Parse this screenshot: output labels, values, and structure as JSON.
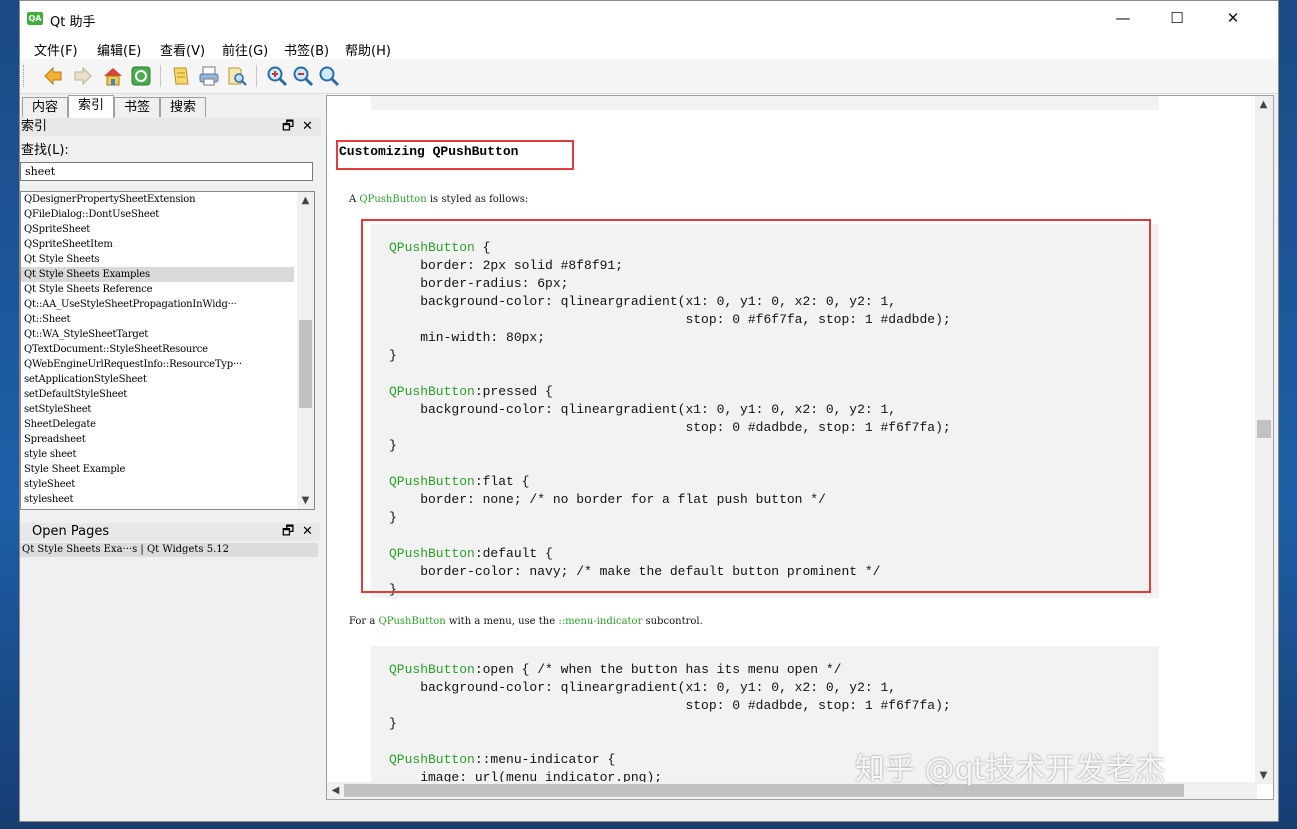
{
  "window": {
    "title": "Qt 助手",
    "icon_text": "QA",
    "controls": {
      "minimize": "—",
      "maximize": "☐",
      "close": "✕"
    }
  },
  "menubar": [
    "文件(F)",
    "编辑(E)",
    "查看(V)",
    "前往(G)",
    "书签(B)",
    "帮助(H)"
  ],
  "toolbar": {
    "buttons": [
      "back-arrow-icon",
      "forward-arrow-icon",
      "home-icon",
      "sync-icon",
      "bookmarks-icon",
      "print-icon",
      "find-icon",
      "zoom-in-icon",
      "zoom-out-icon",
      "zoom-reset-icon"
    ]
  },
  "left_panel": {
    "tabs": [
      "内容",
      "索引",
      "书签",
      "搜索"
    ],
    "active_tab": "索引",
    "index_dock_title": "索引",
    "find_label": "查找(L):",
    "find_value": "sheet",
    "index_items": [
      "QDesignerPropertySheetExtension",
      "QFileDialog::DontUseSheet",
      "QSpriteSheet",
      "QSpriteSheetItem",
      "Qt Style Sheets",
      "Qt Style Sheets Examples",
      "Qt Style Sheets Reference",
      "Qt::AA_UseStyleSheetPropagationInWidg···",
      "Qt::Sheet",
      "Qt::WA_StyleSheetTarget",
      "QTextDocument::StyleSheetResource",
      "QWebEngineUrlRequestInfo::ResourceTyp···",
      "setApplicationStyleSheet",
      "setDefaultStyleSheet",
      "setStyleSheet",
      "SheetDelegate",
      "Spreadsheet",
      "style sheet",
      "Style Sheet Example",
      "styleSheet",
      "stylesheet"
    ],
    "selected_index": 5,
    "open_pages_title": "Open Pages",
    "open_pages": [
      "Qt Style Sheets Exa···s | Qt Widgets 5.12"
    ],
    "dock_float": "🗗",
    "dock_close": "✕"
  },
  "content": {
    "heading": "Customizing QPushButton",
    "intro_prefix": "A ",
    "intro_link": "QPushButton",
    "intro_suffix": " is styled as follows:",
    "code1": [
      [
        "QPushButton",
        " {"
      ],
      [
        "",
        "    border: 2px solid #8f8f91;"
      ],
      [
        "",
        "    border-radius: 6px;"
      ],
      [
        "",
        "    background-color: qlineargradient(x1: 0, y1: 0, x2: 0, y2: 1,"
      ],
      [
        "",
        "                                      stop: 0 #f6f7fa, stop: 1 #dadbde);"
      ],
      [
        "",
        "    min-width: 80px;"
      ],
      [
        "",
        "}"
      ],
      [
        "",
        ""
      ],
      [
        "QPushButton",
        ":pressed {"
      ],
      [
        "",
        "    background-color: qlineargradient(x1: 0, y1: 0, x2: 0, y2: 1,"
      ],
      [
        "",
        "                                      stop: 0 #dadbde, stop: 1 #f6f7fa);"
      ],
      [
        "",
        "}"
      ],
      [
        "",
        ""
      ],
      [
        "QPushButton",
        ":flat {"
      ],
      [
        "",
        "    border: none; /* no border for a flat push button */"
      ],
      [
        "",
        "}"
      ],
      [
        "",
        ""
      ],
      [
        "QPushButton",
        ":default {"
      ],
      [
        "",
        "    border-color: navy; /* make the default button prominent */"
      ],
      [
        "",
        "}"
      ]
    ],
    "menu_para": {
      "prefix": "For a ",
      "link1": "QPushButton",
      "mid": " with a menu, use the ",
      "link2": "::menu-indicator",
      "suffix": " subcontrol."
    },
    "code2": [
      [
        "QPushButton",
        ":open { /* when the button has its menu open */"
      ],
      [
        "",
        "    background-color: qlineargradient(x1: 0, y1: 0, x2: 0, y2: 1,"
      ],
      [
        "",
        "                                      stop: 0 #dadbde, stop: 1 #f6f7fa);"
      ],
      [
        "",
        "}"
      ],
      [
        "",
        ""
      ],
      [
        "QPushButton",
        "::menu-indicator {"
      ],
      [
        "",
        "    image: url(menu_indicator.png);"
      ]
    ]
  },
  "watermark": "知乎 @qt技术开发老杰",
  "colors": {
    "accent_green": "#2aa02a",
    "highlight_red": "#e53a3a"
  }
}
